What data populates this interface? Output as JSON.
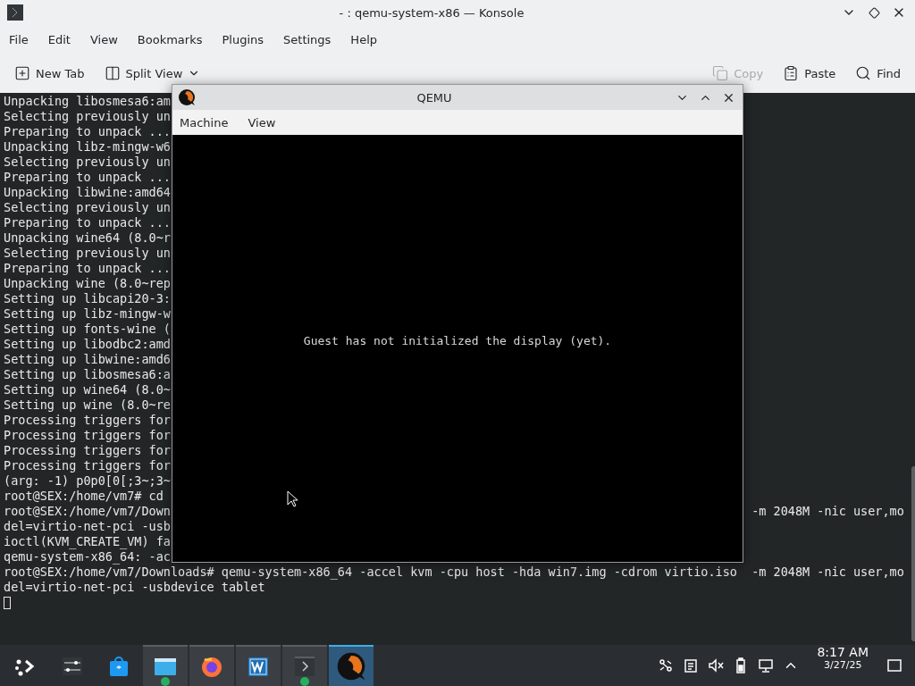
{
  "window": {
    "title": "- : qemu-system-x86 — Konsole"
  },
  "menu": [
    "File",
    "Edit",
    "View",
    "Bookmarks",
    "Plugins",
    "Settings",
    "Help"
  ],
  "toolbar": [
    {
      "kind": "newtab",
      "label": "New Tab",
      "disabled": false
    },
    {
      "kind": "split",
      "label": "Split View",
      "disabled": false
    },
    {
      "kind": "copy",
      "label": "Copy",
      "disabled": true
    },
    {
      "kind": "paste",
      "label": "Paste",
      "disabled": false
    },
    {
      "kind": "find",
      "label": "Find",
      "disabled": false
    }
  ],
  "terminal": {
    "lines": [
      {
        "text": "Unpacking libosmesa6:am"
      },
      {
        "text": "Selecting previously un"
      },
      {
        "text": "Preparing to unpack ..."
      },
      {
        "text": "Unpacking libz-mingw-w6"
      },
      {
        "text": "Selecting previously un"
      },
      {
        "text": "Preparing to unpack ..."
      },
      {
        "text": "Unpacking libwine:amd64"
      },
      {
        "text": "Selecting previously un"
      },
      {
        "text": "Preparing to unpack ..."
      },
      {
        "text": "Unpacking wine64 (8.0~r"
      },
      {
        "text": "Selecting previously un"
      },
      {
        "text": "Preparing to unpack ..."
      },
      {
        "text": "Unpacking wine (8.0~rep"
      },
      {
        "text": "Setting up libcapi20-3:"
      },
      {
        "text": "Setting up libz-mingw-w"
      },
      {
        "text": "Setting up fonts-wine ("
      },
      {
        "text": "Setting up libodbc2:amd"
      },
      {
        "text": "Setting up libwine:amd6"
      },
      {
        "text": "Setting up libosmesa6:a"
      },
      {
        "text": "Setting up wine64 (8.0~"
      },
      {
        "text": "Setting up wine (8.0~re"
      },
      {
        "text": "Processing triggers for"
      },
      {
        "text": "Processing triggers for"
      },
      {
        "text": "Processing triggers for"
      },
      {
        "text": "Processing triggers for"
      },
      {
        "text": "(arg: -1) p0p0[0[;3~;3~"
      },
      {
        "text": "root@SEX:/home/vm7# cd"
      },
      {
        "text": "root@SEX:/home/vm7/Down",
        "right": "-m 2048M -nic user,mo"
      },
      {
        "text": "del=virtio-net-pci -usb"
      },
      {
        "text": "ioctl(KVM_CREATE_VM) fa"
      },
      {
        "text": "qemu-system-x86_64: -ac"
      },
      {
        "text": "root@SEX:/home/vm7/Downloads# qemu-system-x86_64 -accel kvm -cpu host -hda win7.img -cdrom virtio.iso  -m 2048M -nic user,mo"
      },
      {
        "text": "del=virtio-net-pci -usbdevice tablet"
      }
    ],
    "cursor": true
  },
  "qemu": {
    "title": "QEMU",
    "menu": [
      "Machine",
      "View"
    ],
    "message": "Guest has not initialized the display (yet)."
  },
  "taskbar": {
    "items": [
      {
        "kind": "launcher",
        "open": false,
        "selected": false,
        "badge": false
      },
      {
        "kind": "settings",
        "open": false,
        "selected": false,
        "badge": false
      },
      {
        "kind": "store",
        "open": false,
        "selected": false,
        "badge": false
      },
      {
        "kind": "files",
        "open": true,
        "selected": false,
        "badge": true
      },
      {
        "kind": "browser",
        "open": true,
        "selected": false,
        "badge": false
      },
      {
        "kind": "office",
        "open": true,
        "selected": false,
        "badge": false
      },
      {
        "kind": "terminal",
        "open": true,
        "selected": false,
        "badge": true
      },
      {
        "kind": "qemu",
        "open": true,
        "selected": true,
        "badge": false
      }
    ],
    "time": "8:17 AM",
    "date": "3/27/25"
  }
}
